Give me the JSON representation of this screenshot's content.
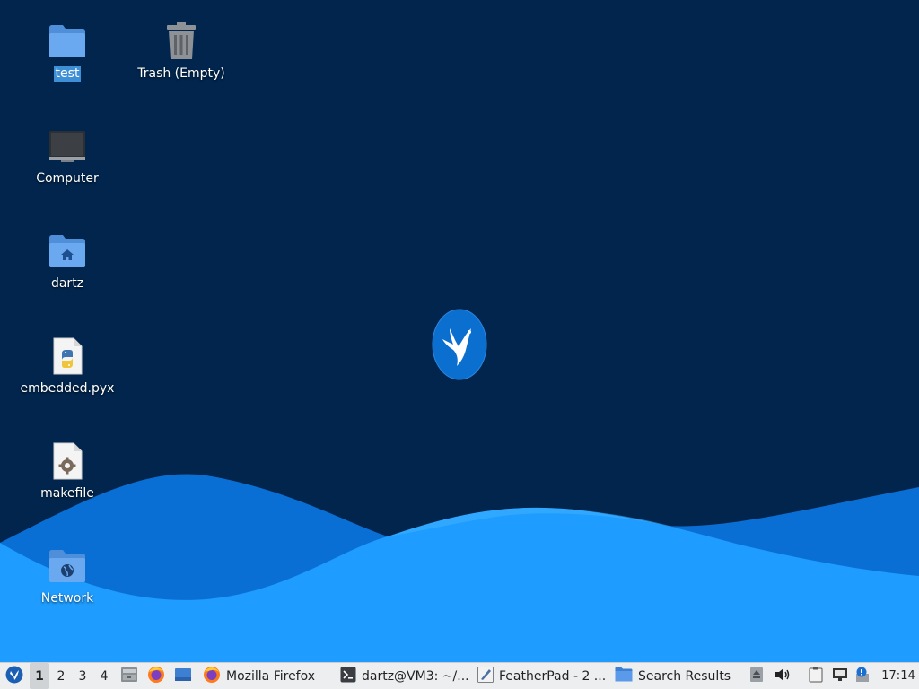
{
  "desktop": {
    "icons": [
      {
        "name": "test",
        "selected": true,
        "icon": "folder-icon"
      },
      {
        "name": "Trash (Empty)",
        "selected": false,
        "icon": "trash-icon"
      },
      {
        "name": "Computer",
        "selected": false,
        "icon": "computer-icon"
      },
      {
        "name": "dartz",
        "selected": false,
        "icon": "home-folder-icon"
      },
      {
        "name": "embedded.pyx",
        "selected": false,
        "icon": "python-file-icon"
      },
      {
        "name": "makefile",
        "selected": false,
        "icon": "makefile-icon"
      },
      {
        "name": "Network",
        "selected": false,
        "icon": "network-folder-icon"
      }
    ],
    "wallpaper_logo": "lubuntu-bird-logo",
    "colors": {
      "background": "#01254d",
      "wave_light": "#1b9bff",
      "wave_dark": "#0a70d6"
    }
  },
  "taskbar": {
    "start_icon": "lubuntu-menu-icon",
    "workspaces": [
      "1",
      "2",
      "3",
      "4"
    ],
    "active_workspace": "1",
    "launchers": [
      "file-manager-icon",
      "firefox-icon",
      "show-desktop-icon"
    ],
    "tasks": [
      {
        "title": "Mozilla Firefox",
        "icon": "firefox-icon"
      },
      {
        "title": "dartz@VM3: ~/...",
        "icon": "terminal-icon"
      },
      {
        "title": "FeatherPad - 2 ...",
        "icon": "featherpad-icon"
      },
      {
        "title": "Search Results",
        "icon": "folder-icon"
      }
    ],
    "tray": [
      "eject-icon",
      "volume-icon",
      "clipboard-icon",
      "network-icon",
      "update-notifier-icon"
    ],
    "clock": "17:14"
  }
}
